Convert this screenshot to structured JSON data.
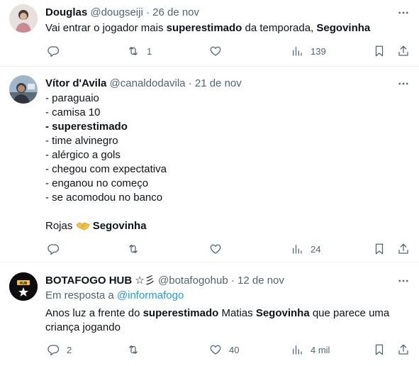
{
  "tweets": [
    {
      "author": "Douglas",
      "handle": "@dougseiji",
      "sep": "·",
      "date": "26 de nov",
      "text_parts": [
        "Vai entrar o jogador mais ",
        "superestimado",
        " da temporada, ",
        "Segovinha"
      ],
      "replies": "",
      "retweets": "1",
      "likes": "",
      "views": "139"
    },
    {
      "author": "Vítor d'Avila",
      "handle": "@canaldodavila",
      "sep": "·",
      "date": "21 de nov",
      "lines": [
        "- paraguaio",
        "- camisa 10",
        "- superestimado",
        "- time alvinegro",
        "- alérgico a gols",
        "- chegou com expectativa",
        "- enganou no começo",
        "- se acomodou no banco"
      ],
      "closing_left": "Rojas",
      "closing_emoji": "handshake",
      "closing_right": "Segovinha",
      "replies": "",
      "retweets": "",
      "likes": "",
      "views": "24"
    },
    {
      "author": "BOTAFOGO HUB",
      "author_suffix": "☆彡",
      "handle": "@botafogohub",
      "sep": "·",
      "date": "12 de nov",
      "reply_prefix": "Em resposta a",
      "reply_handle": "@informafogo",
      "text_parts": [
        "Anos luz a frente do ",
        "superestimado",
        " Matias ",
        "Segovinha",
        " que parece uma",
        "criança jogando"
      ],
      "replies": "2",
      "retweets": "",
      "likes": "40",
      "views": "4 mil",
      "avatar_badge": "HUB"
    }
  ],
  "icons": {
    "more": "more-horizontal-icon",
    "reply": "reply-icon",
    "retweet": "retweet-icon",
    "like": "heart-icon",
    "views": "views-icon",
    "bookmark": "bookmark-icon",
    "share": "share-icon"
  },
  "colors": {
    "text": "#0f1419",
    "secondary": "#536471",
    "link": "#1d9bf0",
    "border": "#eff3f4"
  }
}
